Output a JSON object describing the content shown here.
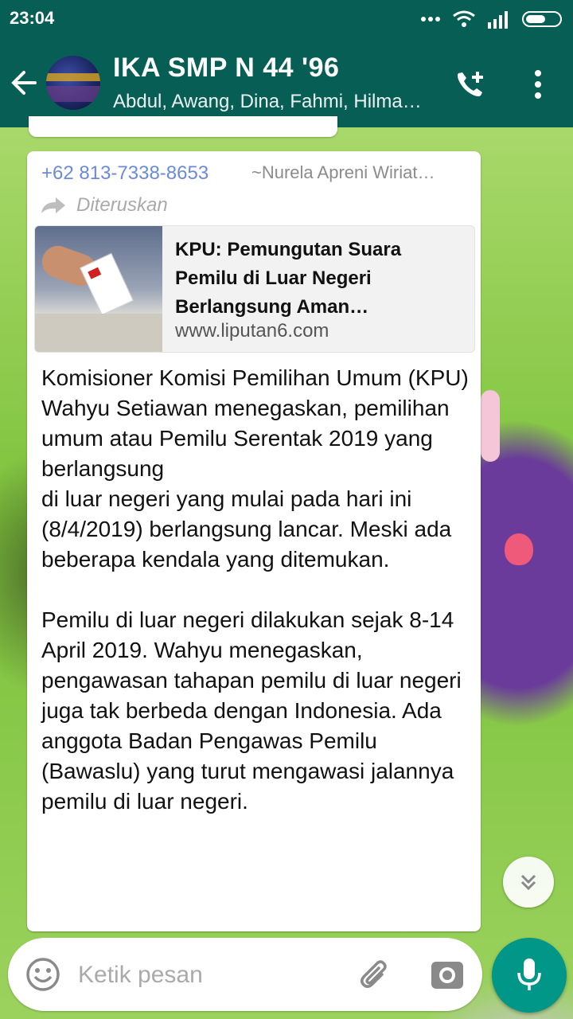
{
  "status_bar": {
    "time": "23:04",
    "icons": [
      "more-dots-icon",
      "wifi-icon",
      "signal-icon",
      "battery-icon"
    ]
  },
  "header": {
    "title": "IKA SMP N 44 '96",
    "subtitle": "Abdul, Awang, Dina, Fahmi, Hilma…",
    "icons": [
      "back-arrow-icon",
      "add-call-icon",
      "overflow-menu-icon"
    ]
  },
  "message": {
    "sender_phone": "+62 813-7338-8653",
    "sender_name": "~Nurela Apreni Wiriat…",
    "forwarded_label": "Diteruskan",
    "link_preview": {
      "title": "KPU: Pemungutan Suara Pemilu di Luar Negeri Berlangsung Aman…",
      "url": "www.liputan6.com"
    },
    "body": "Komisioner Komisi Pemilihan Umum (KPU) Wahyu Setiawan menegaskan, pemilihan umum atau Pemilu Serentak 2019 yang berlangsung\ndi luar negeri yang mulai pada hari ini (8/4/2019) berlangsung lancar. Meski ada beberapa kendala yang ditemukan.\n\nPemilu di luar negeri dilakukan sejak 8-14 April 2019. Wahyu menegaskan, pengawasan tahapan pemilu di luar negeri juga tak berbeda dengan Indonesia. Ada anggota Badan Pengawas Pemilu (Bawaslu) yang turut mengawasi jalannya pemilu di luar negeri."
  },
  "composer": {
    "placeholder": "Ketik pesan",
    "icons": [
      "emoji-icon",
      "attach-icon",
      "camera-icon",
      "mic-icon"
    ]
  },
  "colors": {
    "app_bar": "#075e54",
    "accent": "#009688",
    "sender": "#6b8ad8"
  }
}
